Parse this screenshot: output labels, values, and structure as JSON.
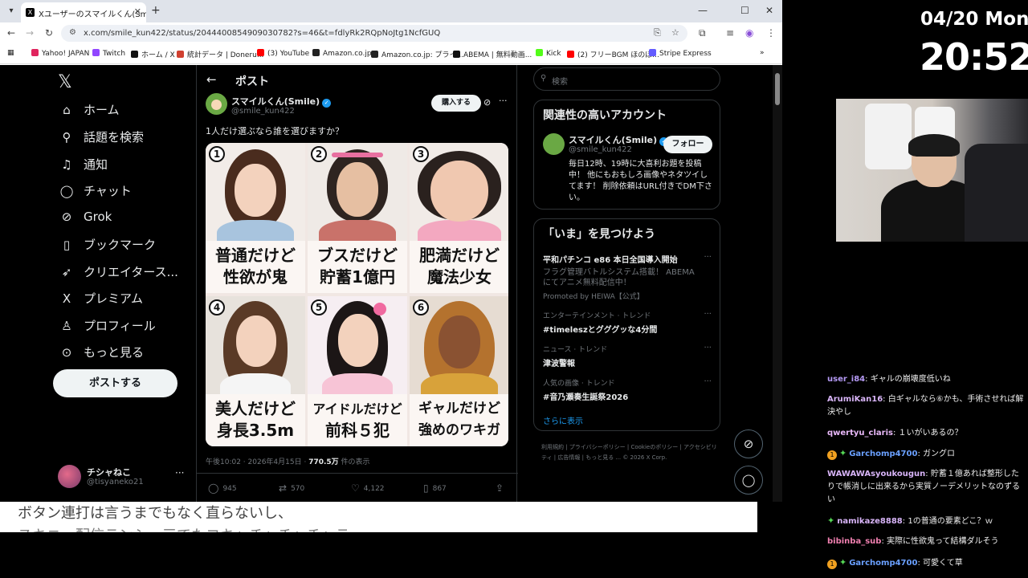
{
  "browser": {
    "tab_title": "Xユーザーのスマイルくん(Smile)さん",
    "url": "x.com/smile_kun422/status/2044400854909030782?s=46&t=fdlyRk2RQpNoJtg1NcfGUQ",
    "bookmarks": [
      "Yahoo! JAPAN",
      "Twitch",
      "ホーム / X",
      "統計データ | Doneru...",
      "(3) YouTube",
      "Amazon.co.jp",
      "Amazon.co.jp: プライ...",
      "ABEMA | 無料動画...",
      "Kick",
      "(2) フリーBGM ほのぼ...",
      "Stripe Express"
    ],
    "bookmark_colors": [
      "#e0245e",
      "#9146ff",
      "#111111",
      "#d04030",
      "#ff0000",
      "#222222",
      "#222222",
      "#111111",
      "#53fc18",
      "#ff0000",
      "#635bff"
    ]
  },
  "x": {
    "nav": [
      {
        "icon": "home-icon",
        "glyph": "⌂",
        "label": "ホーム"
      },
      {
        "icon": "search-icon",
        "glyph": "⚲",
        "label": "話題を検索"
      },
      {
        "icon": "bell-icon",
        "glyph": "♫",
        "label": "通知"
      },
      {
        "icon": "chat-icon",
        "glyph": "◯",
        "label": "チャット"
      },
      {
        "icon": "grok-icon",
        "glyph": "⊘",
        "label": "Grok"
      },
      {
        "icon": "bookmark-icon",
        "glyph": "▯",
        "label": "ブックマーク"
      },
      {
        "icon": "rocket-icon",
        "glyph": "➶",
        "label": "クリエイタース..."
      },
      {
        "icon": "x-premium-icon",
        "glyph": "X",
        "label": "プレミアム"
      },
      {
        "icon": "profile-icon",
        "glyph": "♙",
        "label": "プロフィール"
      },
      {
        "icon": "more-icon",
        "glyph": "⊙",
        "label": "もっと見る"
      }
    ],
    "post_button": "ポストする",
    "account": {
      "name": "チシャねこ",
      "handle": "@tisyaneko21",
      "more": "···"
    },
    "header_title": "ポスト",
    "post": {
      "author": "スマイルくん(Smile)",
      "handle": "@smile_kun422",
      "buy_label": "購入する",
      "text": "1人だけ選ぶなら誰を選びますか？",
      "cells": [
        {
          "num": "1",
          "line1": "普通だけど",
          "line2": "性欲が鬼"
        },
        {
          "num": "2",
          "line1": "ブスだけど",
          "line2": "貯蓄1億円"
        },
        {
          "num": "3",
          "line1": "肥満だけど",
          "line2": "魔法少女"
        },
        {
          "num": "4",
          "line1": "美人だけど",
          "line2": "身長3.5m"
        },
        {
          "num": "5",
          "line1": "アイドルだけど",
          "line2": "前科５犯"
        },
        {
          "num": "6",
          "line1": "ギャルだけど",
          "line2": "強めのワキガ"
        }
      ],
      "time": "午後10:02 · 2026年4月15日 · ",
      "views": "770.5万",
      "views_label": " 件の表示",
      "replies": "945",
      "reposts": "570",
      "likes": "4,122",
      "bookmarks": "867"
    },
    "search_placeholder": "検索",
    "related": {
      "title": "関連性の高いアカウント",
      "name": "スマイルくん(Smile)",
      "handle": "@smile_kun422",
      "follow": "フォロー",
      "bio": "毎日12時、19時に大喜利お題を投稿中！ 他にもおもしろ画像やネタツイしてます！ 削除依頼はURL付きでDM下さい。"
    },
    "trends": {
      "title": "「いま」を見つけよう",
      "items": [
        {
          "label": "",
          "title": "平和パチンコ e86 本日全国導入開始",
          "desc": "フラグ管理バトルシステム搭載！ ABEMA にてアニメ無料配信中！",
          "promo": "Promoted by HEIWA【公式】"
        },
        {
          "label": "エンターテインメント · トレンド",
          "title": "#timeleszとグググッな4分間",
          "desc": "",
          "promo": ""
        },
        {
          "label": "ニュース · トレンド",
          "title": "津波警報",
          "desc": "",
          "promo": ""
        },
        {
          "label": "人気の画像 · トレンド",
          "title": "#音乃瀬奏生誕祭2026",
          "desc": "",
          "promo": ""
        }
      ],
      "show_more": "さらに表示"
    },
    "footer_links": "利用規約 | プライバシーポリシー | Cookieのポリシー | アクセシビリティ | 広告情報 | もっと見る ... © 2026 X Corp."
  },
  "overlay": {
    "date": "04/20 Mon",
    "time": "20:52",
    "subtitle1": "ボタン連打は言うまでもなく直らないし、",
    "subtitle2": "スキニー配信テンシュ三でたコキャチャチャチャテ...",
    "chat": [
      {
        "badge": "",
        "user": "user_i84",
        "color": "#b59af5",
        "text": "ギャルの崩壊度低いね"
      },
      {
        "badge": "",
        "user": "ArumiKan16",
        "color": "#d8b4f8",
        "text": "白ギャルなら⑥かも、手術させれば解決やし"
      },
      {
        "badge": "",
        "user": "qwertyu_claris",
        "color": "#e8b8f8",
        "text": "１いがいあるの？"
      },
      {
        "badge": "both",
        "user": "Garchomp4700",
        "color": "#6aa0ff",
        "text": "ガングロ"
      },
      {
        "badge": "",
        "user": "WAWAWAsyoukougun",
        "color": "#d8b4f8",
        "text": "貯蓄１億あれば整形したりで帳消しに出来るから実質ノーデメリットなのずるい"
      },
      {
        "badge": "green",
        "user": "namikaze8888",
        "color": "#d8b4f8",
        "text": "1の普通の要素どこ？ｗ"
      },
      {
        "badge": "",
        "user": "bibinba_sub",
        "color": "#f080b0",
        "text": "実際に性欲鬼って結構ダルそう"
      },
      {
        "badge": "both",
        "user": "Garchomp4700",
        "color": "#6aa0ff",
        "text": "可愛くて草"
      }
    ]
  }
}
